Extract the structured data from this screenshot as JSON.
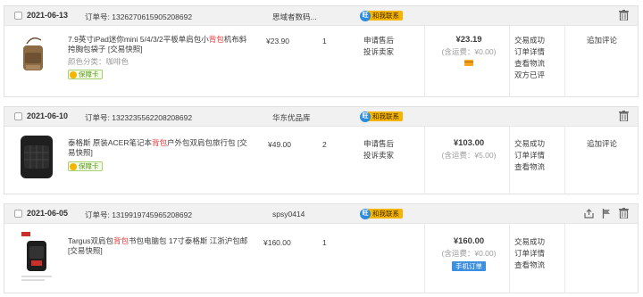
{
  "orders": [
    {
      "date": "2021-06-13",
      "order_label": "订单号:",
      "order_no": "1326270615905208692",
      "shop": "思域者数码...",
      "contact": "和我联系",
      "item": {
        "title_pre": "7.9英寸iPad迷你mini 5/4/3/2平板单肩包小",
        "title_hl": "背包",
        "title_post": "机布斜挎胸包袋子 [交易快照]",
        "sku": "颜色分类：咖啡色",
        "guarantee": "保障卡",
        "price": "¥23.90",
        "qty": "1",
        "service_links": [
          "申请售后",
          "投诉卖家"
        ]
      },
      "total": "¥23.19",
      "shipping": "(含运费：¥0.00)",
      "status_links": [
        "交易成功",
        "订单详情",
        "查看物流",
        "双方已评"
      ],
      "action": "追加评论"
    },
    {
      "date": "2021-06-10",
      "order_label": "订单号:",
      "order_no": "1323235562208208692",
      "shop": "华东优品库",
      "contact": "和我联系",
      "item": {
        "title_pre": "泰格斯 原装ACER笔记本",
        "title_hl": "背包",
        "title_post": "户外包双肩包旅行包 [交易快照]",
        "guarantee": "保障卡",
        "price": "¥49.00",
        "qty": "2",
        "service_links": [
          "申请售后",
          "投诉卖家"
        ]
      },
      "total": "¥103.00",
      "shipping": "(含运费：¥5.00)",
      "status_links": [
        "交易成功",
        "订单详情",
        "查看物流"
      ],
      "action": "追加评论"
    },
    {
      "date": "2021-06-05",
      "order_label": "订单号:",
      "order_no": "1319919745965208692",
      "shop": "spsy0414",
      "contact": "和我联系",
      "item": {
        "title_pre": "Targus双肩包",
        "title_hl": "背包",
        "title_post": "书包电脑包 17寸泰格斯 江浙沪包邮 [交易快照]",
        "price": "¥160.00",
        "qty": "1"
      },
      "total": "¥160.00",
      "shipping": "(含运费：¥0.00)",
      "mobile_tag": "手机订单",
      "status_links": [
        "交易成功",
        "订单详情",
        "查看物流"
      ]
    }
  ]
}
